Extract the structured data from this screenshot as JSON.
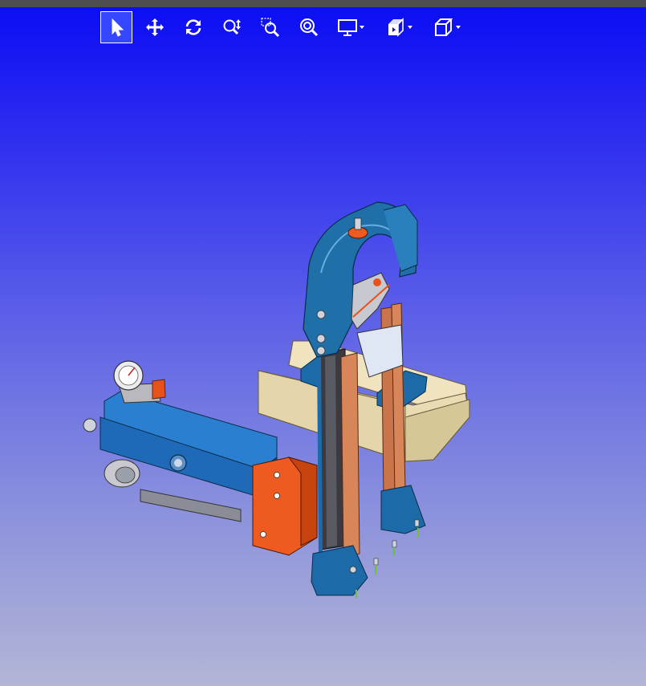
{
  "window": {
    "title_bar_color": "#4d4d52"
  },
  "viewport": {
    "background_top": "#0a0cf5",
    "background_bottom": "#b3b6d6"
  },
  "toolbar": {
    "tools": [
      {
        "icon": "select-cursor-icon",
        "active": true
      },
      {
        "icon": "pan-move-icon",
        "active": false
      },
      {
        "icon": "rotate-icon",
        "active": false
      },
      {
        "icon": "zoom-in-out-icon",
        "active": false
      },
      {
        "icon": "zoom-box-icon",
        "active": false
      },
      {
        "icon": "zoom-fit-icon",
        "active": false
      },
      {
        "icon": "display-mode-icon",
        "active": false,
        "dropdown": true
      },
      {
        "icon": "section-view-icon",
        "active": false,
        "dropdown": true
      },
      {
        "icon": "view-cube-icon",
        "active": false,
        "dropdown": true
      }
    ]
  },
  "model": {
    "description_colors": {
      "body": "#1f6fa8",
      "accent": "#e8521a",
      "beam": "#e8d9b0",
      "rail": "#d98a5a"
    }
  }
}
